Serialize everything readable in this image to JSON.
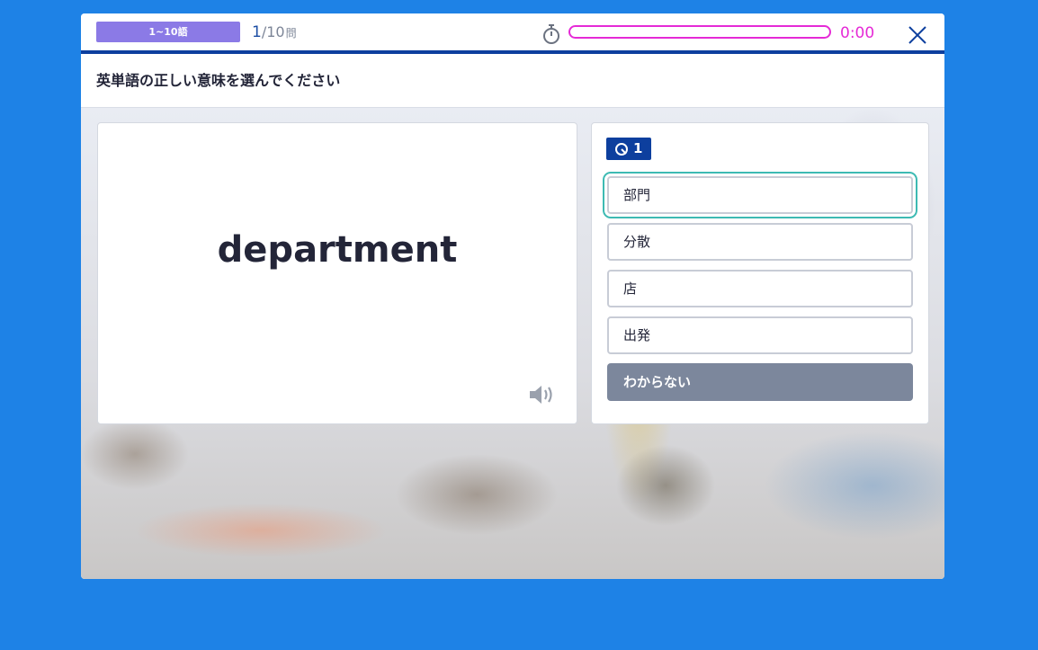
{
  "header": {
    "range_label": "1~10語",
    "progress_current": "1",
    "progress_total": "/10",
    "progress_unit": "問",
    "timer_text": "0:00",
    "timer_fraction": 0.0,
    "timer_color": "#e52ad6"
  },
  "instruction": "英単語の正しい意味を選んでください",
  "word_card": {
    "word": "department"
  },
  "choices_card": {
    "question_number": "1",
    "choices": [
      "部門",
      "分散",
      "店",
      "出発"
    ],
    "selected_index": 0,
    "unknown_label": "わからない"
  },
  "colors": {
    "page_bg": "#1e82e6",
    "accent_navy": "#0d3f9e",
    "badge_purple": "#8b7ae6",
    "selected_outline": "#3dbab3",
    "unknown_button": "#7c879c"
  },
  "icons": {
    "stopwatch": "stopwatch-icon",
    "close": "close-icon",
    "speaker": "speaker-icon",
    "question": "question-timer-icon"
  }
}
